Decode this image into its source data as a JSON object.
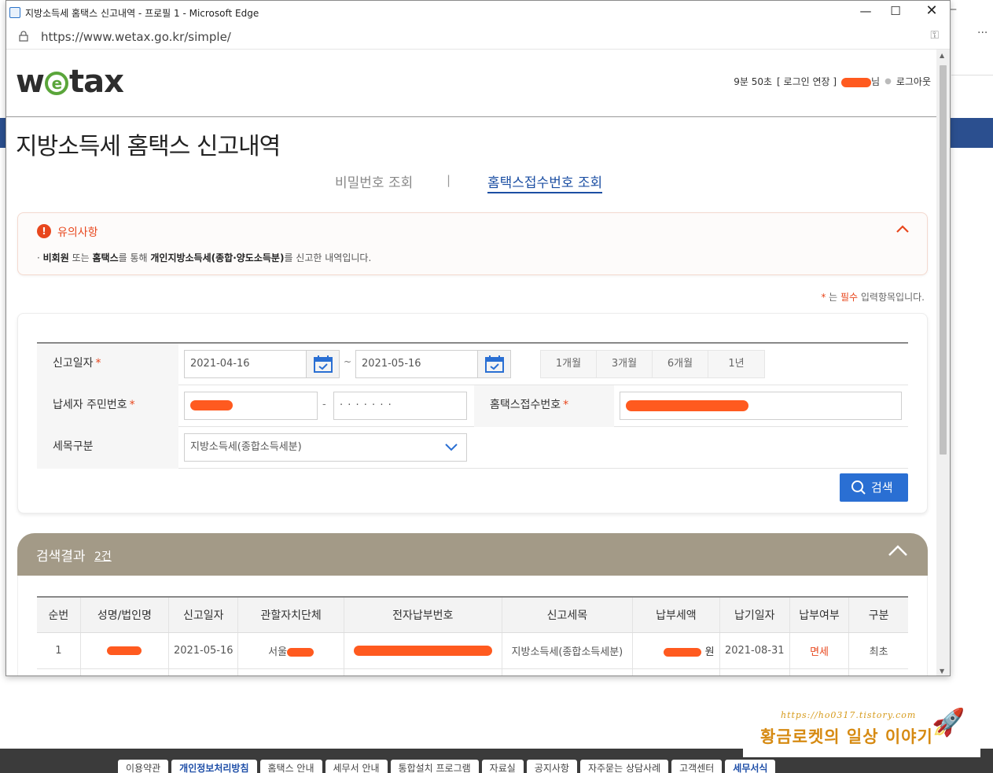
{
  "window": {
    "title": "지방소득세 홈택스 신고내역 - 프로필 1 - Microsoft Edge",
    "url": "https://www.wetax.go.kr/simple/"
  },
  "header": {
    "logo": "wetax",
    "session_timer": "9분 50초",
    "extend_login": "[ 로그인 연장 ]",
    "user_suffix": "님",
    "logout": "로그아웃"
  },
  "page": {
    "title": "지방소득세 홈택스 신고내역",
    "tabs": [
      {
        "label": "비밀번호 조회",
        "active": false
      },
      {
        "label": "홈택스접수번호 조회",
        "active": true
      }
    ]
  },
  "notice": {
    "title": "유의사항",
    "body_prefix": "· ",
    "body_bold_1": "비회원",
    "body_text_1": " 또는 ",
    "body_bold_2": "홈택스",
    "body_text_2": "를 통해 ",
    "body_bold_3": "개인지방소득세(종합·양도소득분)",
    "body_text_3": "를 신고한 내역입니다."
  },
  "required_note": {
    "star": "*",
    "prefix": " 는 ",
    "word": "필수",
    "suffix": " 입력항목입니다."
  },
  "form": {
    "report_date_label": "신고일자",
    "date_from": "2021-04-16",
    "date_to": "2021-05-16",
    "date_sep": "~",
    "periods": [
      "1개월",
      "3개월",
      "6개월",
      "1년"
    ],
    "rrn_label": "납세자 주민번호",
    "rrn_sep": "-",
    "rrn_back": "· · · · · · ·",
    "hometax_no_label": "홈택스접수번호",
    "tax_type_label": "세목구분",
    "tax_type_value": "지방소득세(종합소득세분)",
    "search_button": "검색"
  },
  "results": {
    "title": "검색결과",
    "count": "2건",
    "columns": [
      "순번",
      "성명/법인명",
      "신고일자",
      "관할자치단체",
      "전자납부번호",
      "신고세목",
      "납부세액",
      "납기일자",
      "납부여부",
      "구분"
    ],
    "rows": [
      {
        "no": "1",
        "report_date": "2021-05-16",
        "region_prefix": "서울",
        "tax_item": "지방소득세(종합소득세분)",
        "amount_suffix": "원",
        "due_date": "2021-08-31",
        "paid": "면세",
        "type": "최초"
      }
    ]
  },
  "footer": {
    "links": [
      "이용약관",
      "개인정보처리방침",
      "홈택스 안내",
      "세무서 안내",
      "통합설치 프로그램",
      "자료실",
      "공지사항",
      "자주묻는 상담사례",
      "고객센터",
      "세무서식"
    ]
  },
  "watermark": {
    "url": "https://ho0317.tistory.com",
    "title": "황금로켓의 일상 이야기"
  },
  "colors": {
    "accent_blue": "#2a6fd3",
    "alert_red": "#e8471d",
    "results_header": "#a39a87",
    "logo_green": "#5aa53a"
  }
}
